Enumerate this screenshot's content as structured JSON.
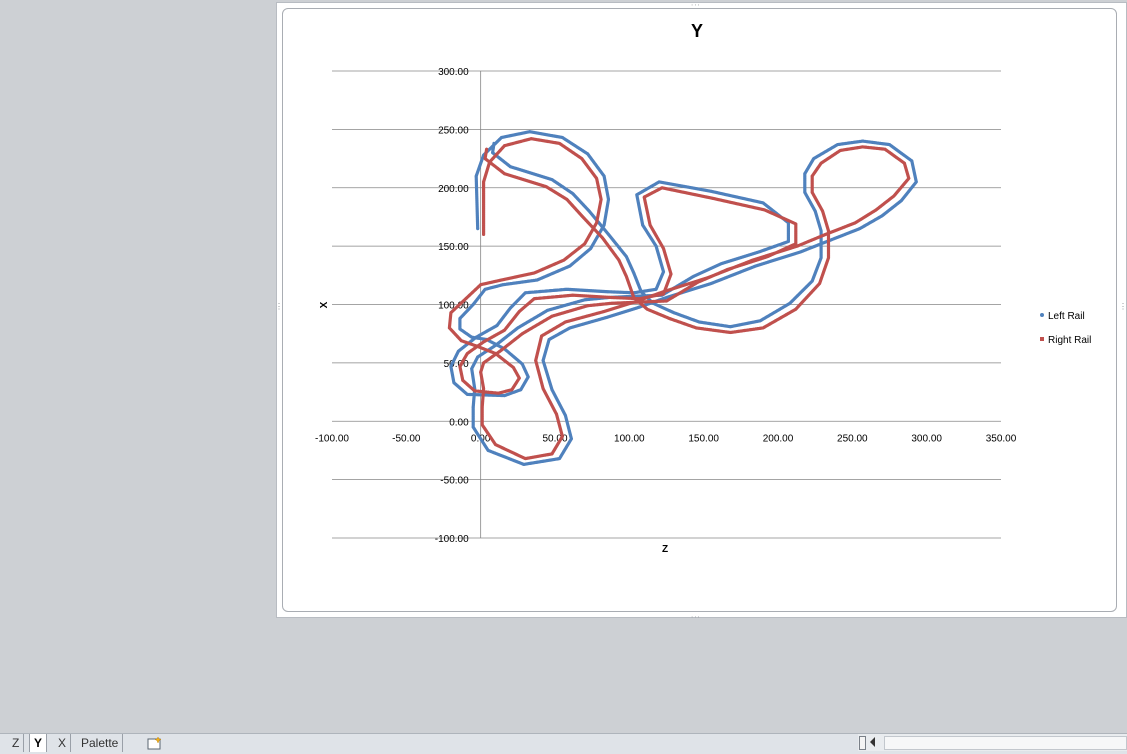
{
  "tabs": [
    {
      "label": "Z",
      "active": false
    },
    {
      "label": "Y",
      "active": true
    },
    {
      "label": "X",
      "active": false
    },
    {
      "label": "Palette",
      "active": false
    }
  ],
  "colors": {
    "left_rail": "#4f81bd",
    "right_rail": "#c0504d",
    "grid": "#868686"
  },
  "chart_data": {
    "type": "scatter",
    "title": "Y",
    "xlabel": "Z",
    "ylabel": "X",
    "xlim": [
      -100,
      350
    ],
    "ylim": [
      -100,
      300
    ],
    "x_ticks": [
      "-100.00",
      "-50.00",
      "0.00",
      "50.00",
      "100.00",
      "150.00",
      "200.00",
      "250.00",
      "300.00",
      "350.00"
    ],
    "y_ticks": [
      "300.00",
      "250.00",
      "200.00",
      "150.00",
      "100.00",
      "50.00",
      "0.00",
      "-50.00",
      "-100.00"
    ],
    "grid": "horizontal",
    "legend": "right",
    "series": [
      {
        "name": "Left Rail",
        "points": [
          [
            -2,
            165
          ],
          [
            -3,
            210
          ],
          [
            2,
            228
          ],
          [
            14,
            243
          ],
          [
            33,
            248
          ],
          [
            55,
            243
          ],
          [
            72,
            229
          ],
          [
            83,
            210
          ],
          [
            86,
            190
          ],
          [
            83,
            168
          ],
          [
            74,
            148
          ],
          [
            60,
            133
          ],
          [
            38,
            121
          ],
          [
            15,
            117
          ],
          [
            3,
            113
          ],
          [
            -5,
            100
          ],
          [
            -14,
            88
          ],
          [
            -14,
            79
          ],
          [
            -6,
            72
          ],
          [
            4,
            70
          ],
          [
            16,
            62
          ],
          [
            28,
            49
          ],
          [
            32,
            38
          ],
          [
            27,
            27
          ],
          [
            16,
            22
          ],
          [
            -9,
            23
          ],
          [
            -18,
            33
          ],
          [
            -20,
            47
          ],
          [
            -15,
            60
          ],
          [
            -3,
            72
          ],
          [
            11,
            82
          ],
          [
            20,
            97
          ],
          [
            30,
            110
          ],
          [
            58,
            113
          ],
          [
            85,
            111
          ],
          [
            103,
            110
          ],
          [
            118,
            113
          ],
          [
            123,
            128
          ],
          [
            118,
            150
          ],
          [
            109,
            168
          ],
          [
            105,
            194
          ],
          [
            120,
            205
          ],
          [
            155,
            197
          ],
          [
            190,
            187
          ],
          [
            207,
            170
          ],
          [
            207,
            154
          ],
          [
            187,
            145
          ],
          [
            162,
            135
          ],
          [
            143,
            124
          ],
          [
            122,
            108
          ],
          [
            103,
            107
          ],
          [
            86,
            106
          ],
          [
            70,
            104
          ],
          [
            45,
            95
          ],
          [
            25,
            80
          ],
          [
            10,
            65
          ],
          [
            -2,
            55
          ],
          [
            -6,
            45
          ],
          [
            -4,
            28
          ],
          [
            -5,
            12
          ],
          [
            -5,
            -5
          ],
          [
            5,
            -25
          ],
          [
            29,
            -37
          ],
          [
            53,
            -32
          ],
          [
            61,
            -15
          ],
          [
            57,
            5
          ],
          [
            48,
            27
          ],
          [
            42,
            52
          ],
          [
            46,
            70
          ],
          [
            60,
            80
          ],
          [
            85,
            89
          ],
          [
            105,
            97
          ],
          [
            125,
            106
          ],
          [
            155,
            118
          ],
          [
            185,
            133
          ],
          [
            215,
            145
          ],
          [
            235,
            155
          ],
          [
            255,
            165
          ],
          [
            270,
            176
          ],
          [
            283,
            189
          ],
          [
            293,
            205
          ],
          [
            290,
            223
          ],
          [
            275,
            237
          ],
          [
            257,
            240
          ],
          [
            240,
            237
          ],
          [
            224,
            225
          ],
          [
            218,
            212
          ],
          [
            218,
            196
          ],
          [
            225,
            180
          ],
          [
            229,
            163
          ],
          [
            229,
            140
          ],
          [
            223,
            120
          ],
          [
            208,
            101
          ],
          [
            188,
            86
          ],
          [
            168,
            81
          ],
          [
            147,
            85
          ],
          [
            130,
            93
          ],
          [
            116,
            101
          ],
          [
            108,
            111
          ],
          [
            103,
            127
          ],
          [
            98,
            141
          ],
          [
            86,
            160
          ],
          [
            73,
            180
          ],
          [
            62,
            195
          ],
          [
            48,
            207
          ],
          [
            20,
            218
          ],
          [
            8,
            230
          ],
          [
            9,
            238
          ]
        ]
      },
      {
        "name": "Right Rail",
        "points": [
          [
            2,
            160
          ],
          [
            2,
            205
          ],
          [
            6,
            222
          ],
          [
            16,
            236
          ],
          [
            34,
            242
          ],
          [
            53,
            238
          ],
          [
            68,
            225
          ],
          [
            78,
            208
          ],
          [
            81,
            190
          ],
          [
            78,
            170
          ],
          [
            70,
            152
          ],
          [
            56,
            138
          ],
          [
            36,
            127
          ],
          [
            14,
            121
          ],
          [
            0,
            117
          ],
          [
            -10,
            105
          ],
          [
            -20,
            93
          ],
          [
            -21,
            80
          ],
          [
            -13,
            69
          ],
          [
            -2,
            64
          ],
          [
            10,
            58
          ],
          [
            22,
            46
          ],
          [
            26,
            37
          ],
          [
            21,
            27
          ],
          [
            12,
            24
          ],
          [
            -4,
            26
          ],
          [
            -12,
            35
          ],
          [
            -14,
            47
          ],
          [
            -9,
            58
          ],
          [
            2,
            68
          ],
          [
            16,
            78
          ],
          [
            26,
            94
          ],
          [
            36,
            105
          ],
          [
            62,
            108
          ],
          [
            88,
            106
          ],
          [
            107,
            105
          ],
          [
            123,
            109
          ],
          [
            128,
            126
          ],
          [
            123,
            148
          ],
          [
            114,
            168
          ],
          [
            110,
            192
          ],
          [
            122,
            200
          ],
          [
            156,
            191
          ],
          [
            191,
            181
          ],
          [
            212,
            169
          ],
          [
            212,
            152
          ],
          [
            193,
            141
          ],
          [
            166,
            130
          ],
          [
            146,
            119
          ],
          [
            125,
            103
          ],
          [
            105,
            102
          ],
          [
            88,
            101
          ],
          [
            72,
            99
          ],
          [
            48,
            90
          ],
          [
            28,
            75
          ],
          [
            13,
            60
          ],
          [
            2,
            50
          ],
          [
            0,
            42
          ],
          [
            2,
            28
          ],
          [
            1,
            12
          ],
          [
            1,
            -3
          ],
          [
            10,
            -20
          ],
          [
            30,
            -32
          ],
          [
            48,
            -28
          ],
          [
            55,
            -13
          ],
          [
            51,
            6
          ],
          [
            42,
            28
          ],
          [
            37,
            52
          ],
          [
            41,
            73
          ],
          [
            57,
            85
          ],
          [
            83,
            94
          ],
          [
            103,
            102
          ],
          [
            123,
            111
          ],
          [
            153,
            123
          ],
          [
            183,
            138
          ],
          [
            213,
            150
          ],
          [
            232,
            160
          ],
          [
            252,
            170
          ],
          [
            266,
            181
          ],
          [
            278,
            193
          ],
          [
            288,
            208
          ],
          [
            285,
            221
          ],
          [
            272,
            233
          ],
          [
            257,
            235
          ],
          [
            242,
            232
          ],
          [
            229,
            221
          ],
          [
            223,
            210
          ],
          [
            223,
            196
          ],
          [
            230,
            180
          ],
          [
            234,
            163
          ],
          [
            234,
            140
          ],
          [
            228,
            118
          ],
          [
            212,
            96
          ],
          [
            190,
            80
          ],
          [
            168,
            76
          ],
          [
            145,
            80
          ],
          [
            127,
            88
          ],
          [
            112,
            96
          ],
          [
            103,
            106
          ],
          [
            98,
            124
          ],
          [
            93,
            138
          ],
          [
            82,
            157
          ],
          [
            68,
            176
          ],
          [
            58,
            190
          ],
          [
            44,
            201
          ],
          [
            16,
            212
          ],
          [
            3,
            225
          ],
          [
            4,
            233
          ]
        ]
      }
    ]
  }
}
